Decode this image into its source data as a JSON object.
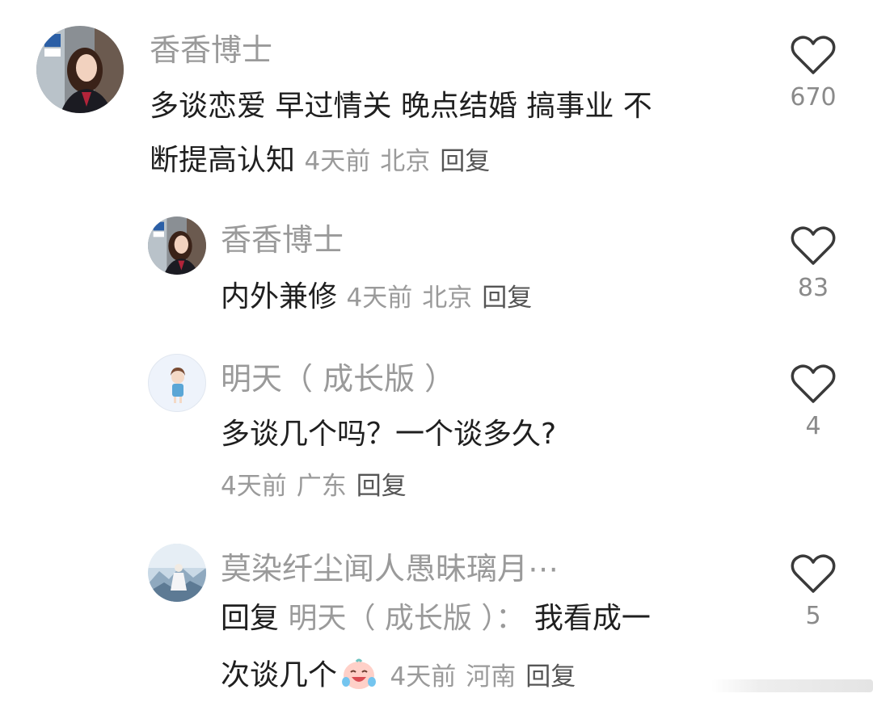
{
  "comments": [
    {
      "username": "香香博士",
      "text_line1": "多谈恋爱 早过情关 晚点结婚 搞事业 不",
      "text_line2": "断提高认知",
      "time": "4天前",
      "location": "北京",
      "reply_label": "回复",
      "likes": "670",
      "avatar": "woman-photo"
    },
    {
      "username": "香香博士",
      "text": "内外兼修",
      "time": "4天前",
      "location": "北京",
      "reply_label": "回复",
      "likes": "83",
      "avatar": "woman-photo"
    },
    {
      "username": "明天（ 成长版 ）",
      "text": "多谈几个吗？一个谈多久?",
      "time": "4天前",
      "location": "广东",
      "reply_label": "回复",
      "likes": "4",
      "avatar": "cartoon-girl"
    },
    {
      "username": "莫染纤尘闻人愚昧璃月⋯",
      "reply_prefix": "回复",
      "reply_target": "明天（ 成长版 ）：",
      "text_line1_rest": "我看成一",
      "text_line2": "次谈几个",
      "emoji": "crying-laughing-emoji",
      "time": "4天前",
      "location": "河南",
      "reply_label": "回复",
      "likes": "5",
      "avatar": "anime-landscape"
    }
  ],
  "icons": {
    "like": "heart-outline-icon"
  },
  "colors": {
    "username": "#9a9a9a",
    "text": "#1f1f1f",
    "meta": "#9a9a9a",
    "heart_stroke": "#3a3a3a"
  }
}
